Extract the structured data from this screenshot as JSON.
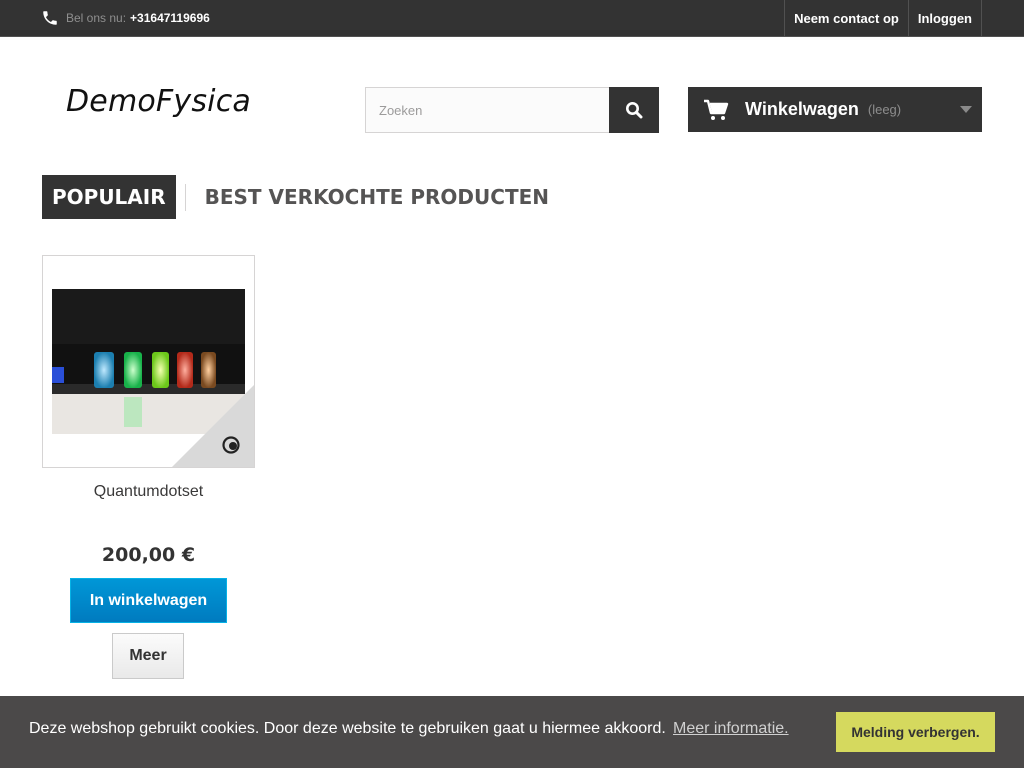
{
  "topbar": {
    "phone_label": "Bel ons nu:",
    "phone_number": "+31647119696",
    "links": [
      "Neem contact op",
      "Inloggen"
    ]
  },
  "header": {
    "logo": "DemoFysica",
    "search_placeholder": "Zoeken",
    "cart_label": "Winkelwagen",
    "cart_status": "(leeg)"
  },
  "tabs": {
    "active": "POPULAIR",
    "inactive": "BEST VERKOCHTE PRODUCTEN"
  },
  "product": {
    "name": "Quantumdotset",
    "price": "200,00 €",
    "add_to_cart": "In winkelwagen",
    "more": "Meer"
  },
  "cookie": {
    "text": "Deze webshop gebruikt cookies. Door deze website te gebruiken gaat u hiermee akkoord.",
    "link": "Meer informatie.",
    "button": "Melding verbergen."
  },
  "colors": {
    "dark": "#333333",
    "cart_button": "#0082c6",
    "cookie_bar": "#4b4949",
    "cookie_button": "#d5d95e"
  }
}
